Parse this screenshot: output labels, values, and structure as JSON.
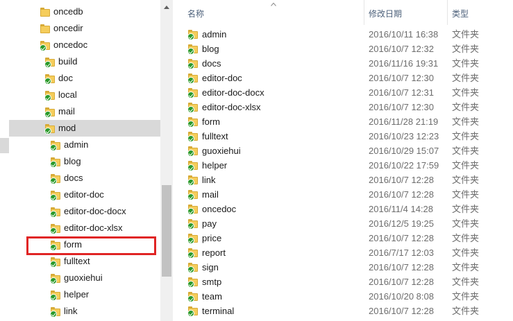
{
  "columns": {
    "name": "名称",
    "date": "修改日期",
    "type": "类型"
  },
  "tree": [
    {
      "label": "oncedb",
      "indent": 0,
      "status": "plain",
      "selected": false
    },
    {
      "label": "oncedir",
      "indent": 0,
      "status": "plain",
      "selected": false
    },
    {
      "label": "oncedoc",
      "indent": 0,
      "status": "synced",
      "selected": false
    },
    {
      "label": "build",
      "indent": 1,
      "status": "synced",
      "selected": false
    },
    {
      "label": "doc",
      "indent": 1,
      "status": "synced",
      "selected": false
    },
    {
      "label": "local",
      "indent": 1,
      "status": "synced",
      "selected": false
    },
    {
      "label": "mail",
      "indent": 1,
      "status": "synced",
      "selected": false
    },
    {
      "label": "mod",
      "indent": 1,
      "status": "synced",
      "selected": true
    },
    {
      "label": "admin",
      "indent": 2,
      "status": "synced",
      "selected": false
    },
    {
      "label": "blog",
      "indent": 2,
      "status": "synced",
      "selected": false
    },
    {
      "label": "docs",
      "indent": 2,
      "status": "synced",
      "selected": false
    },
    {
      "label": "editor-doc",
      "indent": 2,
      "status": "synced",
      "selected": false
    },
    {
      "label": "editor-doc-docx",
      "indent": 2,
      "status": "synced",
      "selected": false
    },
    {
      "label": "editor-doc-xlsx",
      "indent": 2,
      "status": "synced",
      "selected": false
    },
    {
      "label": "form",
      "indent": 2,
      "status": "synced",
      "selected": false,
      "highlighted": true
    },
    {
      "label": "fulltext",
      "indent": 2,
      "status": "synced",
      "selected": false
    },
    {
      "label": "guoxiehui",
      "indent": 2,
      "status": "synced",
      "selected": false
    },
    {
      "label": "helper",
      "indent": 2,
      "status": "synced",
      "selected": false
    },
    {
      "label": "link",
      "indent": 2,
      "status": "synced",
      "selected": false
    }
  ],
  "files": [
    {
      "name": "admin",
      "date": "2016/10/11 16:38",
      "type": "文件夹"
    },
    {
      "name": "blog",
      "date": "2016/10/7 12:32",
      "type": "文件夹"
    },
    {
      "name": "docs",
      "date": "2016/11/16 19:31",
      "type": "文件夹"
    },
    {
      "name": "editor-doc",
      "date": "2016/10/7 12:30",
      "type": "文件夹"
    },
    {
      "name": "editor-doc-docx",
      "date": "2016/10/7 12:31",
      "type": "文件夹"
    },
    {
      "name": "editor-doc-xlsx",
      "date": "2016/10/7 12:30",
      "type": "文件夹"
    },
    {
      "name": "form",
      "date": "2016/11/28 21:19",
      "type": "文件夹"
    },
    {
      "name": "fulltext",
      "date": "2016/10/23 12:23",
      "type": "文件夹"
    },
    {
      "name": "guoxiehui",
      "date": "2016/10/29 15:07",
      "type": "文件夹"
    },
    {
      "name": "helper",
      "date": "2016/10/22 17:59",
      "type": "文件夹"
    },
    {
      "name": "link",
      "date": "2016/10/7 12:28",
      "type": "文件夹"
    },
    {
      "name": "mail",
      "date": "2016/10/7 12:28",
      "type": "文件夹"
    },
    {
      "name": "oncedoc",
      "date": "2016/11/4 14:28",
      "type": "文件夹"
    },
    {
      "name": "pay",
      "date": "2016/12/5 19:25",
      "type": "文件夹"
    },
    {
      "name": "price",
      "date": "2016/10/7 12:28",
      "type": "文件夹"
    },
    {
      "name": "report",
      "date": "2016/7/17 12:03",
      "type": "文件夹"
    },
    {
      "name": "sign",
      "date": "2016/10/7 12:28",
      "type": "文件夹"
    },
    {
      "name": "smtp",
      "date": "2016/10/7 12:28",
      "type": "文件夹"
    },
    {
      "name": "team",
      "date": "2016/10/20 8:08",
      "type": "文件夹"
    },
    {
      "name": "terminal",
      "date": "2016/10/7 12:28",
      "type": "文件夹"
    }
  ],
  "icons": {
    "folder": "folder-icon",
    "sync_status": "green-check-overlay-icon",
    "sort": "sort-ascending-icon"
  },
  "colors": {
    "selection": "#d9d9d9",
    "highlight_box": "#e02424",
    "folder": "#f5cd5b",
    "check": "#2a9a2a",
    "header_text": "#4c607a"
  }
}
